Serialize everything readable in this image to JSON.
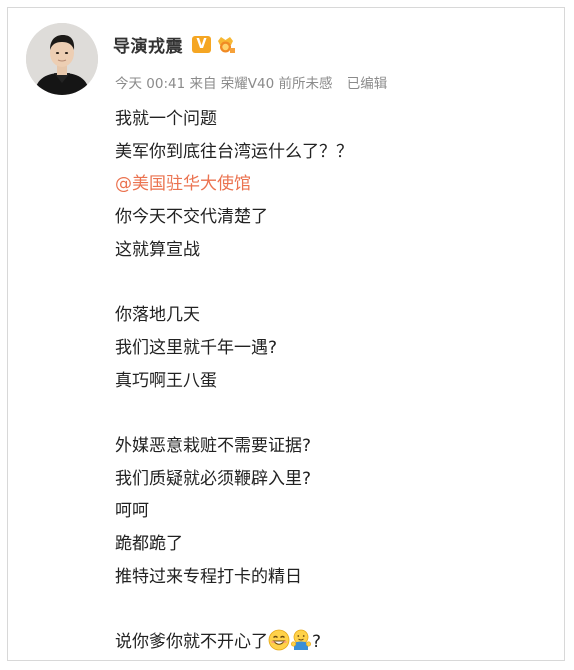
{
  "post": {
    "author": {
      "name": "导演戎震",
      "verified_badge": "V",
      "avatar_icon": "avatar-man-black-shirt"
    },
    "meta": {
      "time": "今天 00:41",
      "source": "来自 荣耀V40 前所未感",
      "edited": "已编辑"
    },
    "lines": [
      "我就一个问题",
      "美军你到底往台湾运什么了？？",
      "@美国驻华大使馆",
      "你今天不交代清楚了",
      "这就算宣战",
      "",
      "你落地几天",
      "我们这里就千年一遇?",
      "真巧啊王八蛋",
      "",
      "外媒恶意栽赃不需要证据?",
      "我们质疑就必须鞭辟入里?",
      "呵呵",
      "跪都跪了",
      "推特过来专程打卡的精日",
      ""
    ],
    "last_line": {
      "text": "说你爹你就不开心了",
      "emojis": [
        "smile-emoji",
        "hug-emoji"
      ],
      "suffix": "?"
    }
  },
  "colors": {
    "mention": "#eb7350",
    "meta": "#8b8b8b",
    "badge": "#f5a623"
  }
}
